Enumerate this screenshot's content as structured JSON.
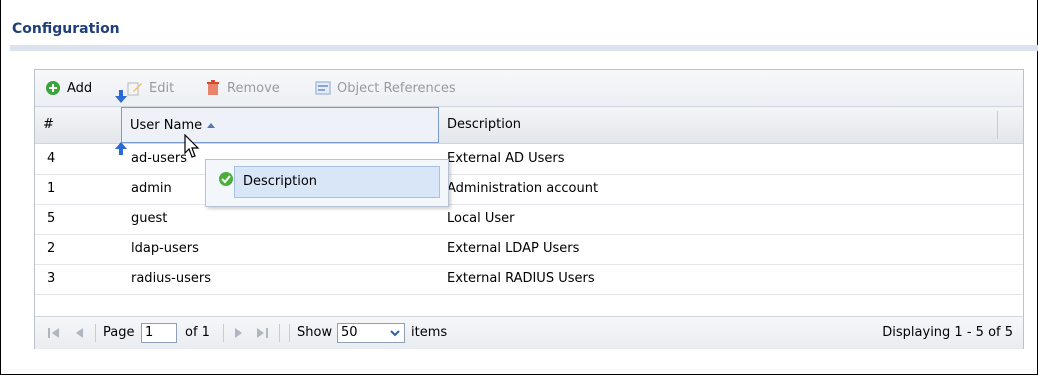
{
  "page": {
    "title": "Configuration"
  },
  "toolbar": {
    "add_label": "Add",
    "edit_label": "Edit",
    "remove_label": "Remove",
    "object_references_label": "Object References"
  },
  "table": {
    "columns": {
      "index": "#",
      "user_name": "User Name",
      "description": "Description"
    },
    "sort": "ascending",
    "rows": [
      {
        "index": "4",
        "user_name": "ad-users",
        "description": "External AD Users"
      },
      {
        "index": "1",
        "user_name": "admin",
        "description": "Administration account"
      },
      {
        "index": "5",
        "user_name": "guest",
        "description": "Local User"
      },
      {
        "index": "2",
        "user_name": "ldap-users",
        "description": "External LDAP Users"
      },
      {
        "index": "3",
        "user_name": "radius-users",
        "description": "External RADIUS Users"
      }
    ]
  },
  "column_menu": {
    "item_label": "Description",
    "checked": true
  },
  "pager": {
    "page_label": "Page",
    "page_value": "1",
    "of_label": "of 1",
    "show_label": "Show",
    "show_value": "50",
    "items_label": "items",
    "displaying": "Displaying 1 - 5 of 5"
  },
  "colors": {
    "title": "#1f3f7a",
    "accent": "#7a9cd0",
    "add_green": "#3aa53a",
    "remove_red": "#d9482b"
  },
  "icons": [
    "add-icon",
    "edit-icon",
    "remove-icon",
    "object-references-icon",
    "sort-ascending-icon",
    "drag-arrow-down-icon",
    "drag-arrow-up-icon",
    "cursor-hand-icon",
    "check-icon",
    "first-page-icon",
    "prev-page-icon",
    "next-page-icon",
    "last-page-icon",
    "dropdown-arrow-icon"
  ]
}
